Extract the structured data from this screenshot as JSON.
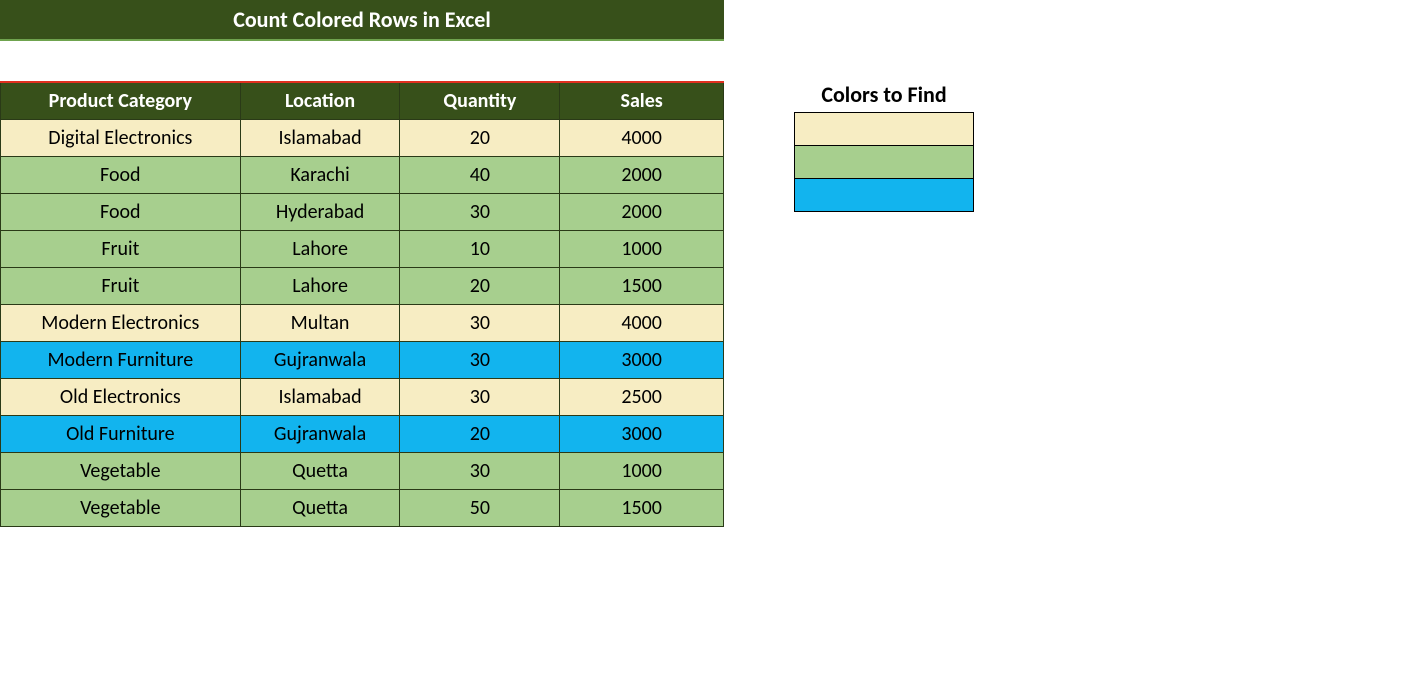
{
  "banner": {
    "title": "Count Colored Rows in Excel"
  },
  "table": {
    "headers": [
      "Product Category",
      "Location",
      "Quantity",
      "Sales"
    ],
    "rows": [
      {
        "cells": [
          "Digital Electronics",
          "Islamabad",
          "20",
          "4000"
        ],
        "colorClass": "c-cream"
      },
      {
        "cells": [
          "Food",
          "Karachi",
          "40",
          "2000"
        ],
        "colorClass": "c-green"
      },
      {
        "cells": [
          "Food",
          "Hyderabad",
          "30",
          "2000"
        ],
        "colorClass": "c-green"
      },
      {
        "cells": [
          "Fruit",
          "Lahore",
          "10",
          "1000"
        ],
        "colorClass": "c-green"
      },
      {
        "cells": [
          "Fruit",
          "Lahore",
          "20",
          "1500"
        ],
        "colorClass": "c-green"
      },
      {
        "cells": [
          "Modern Electronics",
          "Multan",
          "30",
          "4000"
        ],
        "colorClass": "c-cream"
      },
      {
        "cells": [
          "Modern Furniture",
          "Gujranwala",
          "30",
          "3000"
        ],
        "colorClass": "c-blue"
      },
      {
        "cells": [
          "Old Electronics",
          "Islamabad",
          "30",
          "2500"
        ],
        "colorClass": "c-cream"
      },
      {
        "cells": [
          "Old Furniture",
          "Gujranwala",
          "20",
          "3000"
        ],
        "colorClass": "c-blue"
      },
      {
        "cells": [
          "Vegetable",
          "Quetta",
          "30",
          "1000"
        ],
        "colorClass": "c-green"
      },
      {
        "cells": [
          "Vegetable",
          "Quetta",
          "50",
          "1500"
        ],
        "colorClass": "c-green"
      }
    ]
  },
  "side": {
    "title": "Colors to Find",
    "swatches": [
      "c-cream",
      "c-green",
      "c-blue"
    ]
  },
  "colors": {
    "cream": "#f7edc3",
    "green": "#a7cf8e",
    "blue": "#12b4ee",
    "headerBg": "#37501a"
  }
}
